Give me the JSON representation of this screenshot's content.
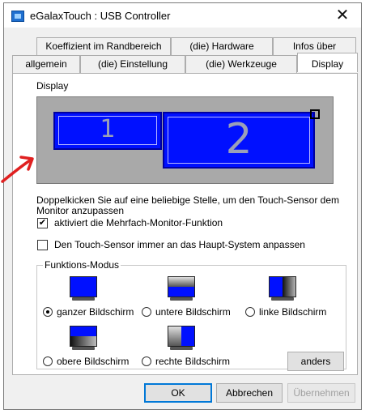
{
  "window": {
    "title": "eGalaxTouch : USB Controller",
    "close_symbol": "✕"
  },
  "tabs_back": [
    {
      "label": "Koeffizient im Randbereich"
    },
    {
      "label": "(die) Hardware"
    },
    {
      "label": "Infos über"
    }
  ],
  "tabs_front": [
    {
      "label": "allgemein"
    },
    {
      "label": "(die) Einstellung"
    },
    {
      "label": "(die) Werkzeuge"
    },
    {
      "label": "Display"
    }
  ],
  "display": {
    "section_label": "Display",
    "monitor_1": "1",
    "monitor_2": "2",
    "hint": "Doppelkicken Sie auf eine beliebige Stelle, um den Touch-Sensor dem Monitor anzupassen"
  },
  "options": {
    "multi_monitor": {
      "label": "aktiviert die Mehrfach-Monitor-Funktion",
      "checked": true,
      "mark": "✔"
    },
    "main_system": {
      "label": "Den Touch-Sensor immer an das Haupt-System anpassen",
      "checked": false
    }
  },
  "function_mode": {
    "title": "Funktions-Modus",
    "modes": [
      {
        "label": "ganzer Bildschirm",
        "selected": true
      },
      {
        "label": "untere Bildschirm",
        "selected": false
      },
      {
        "label": "linke Bildschirm",
        "selected": false
      },
      {
        "label": "obere Bildschirm",
        "selected": false
      },
      {
        "label": "rechte Bildschirm",
        "selected": false
      }
    ],
    "anders_label": "anders"
  },
  "buttons": {
    "ok": "OK",
    "cancel": "Abbrechen",
    "apply": "Übernehmen"
  },
  "colors": {
    "monitor_blue": "#0010ff",
    "display_bg": "#a9a9a9",
    "annotation_arrow": "#e02020",
    "accent": "#0078d7"
  }
}
